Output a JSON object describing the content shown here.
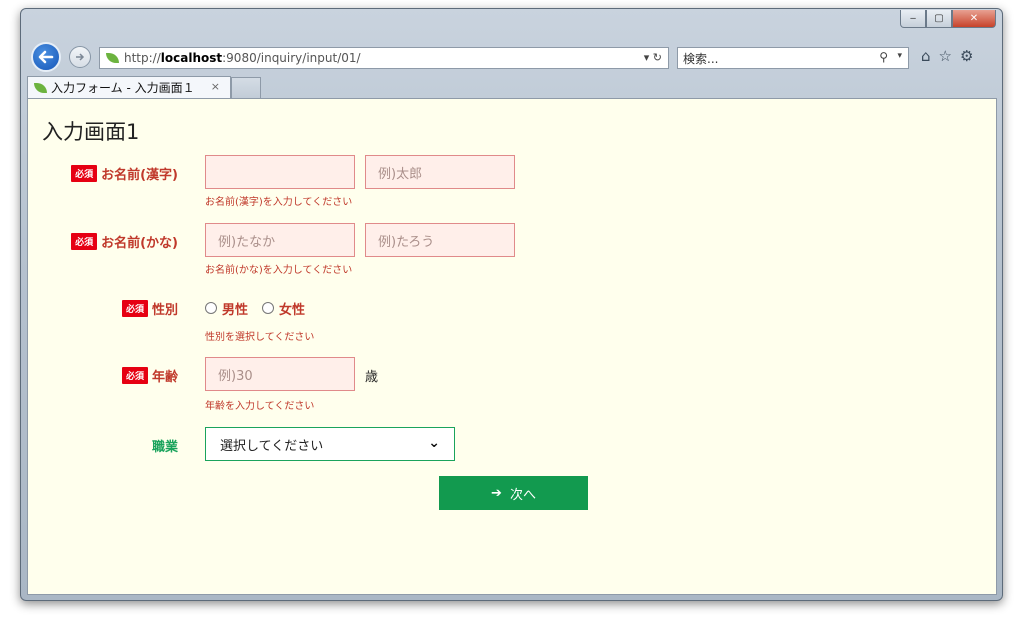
{
  "browser": {
    "url_prefix": "http://",
    "url_host": "localhost",
    "url_rest": ":9080/inquiry/input/01/",
    "address_tools": "▾ ↻",
    "search_placeholder": "検索...",
    "search_icon": "⚲",
    "search_chevron": "▾",
    "window_controls": {
      "minimize": "‒",
      "maximize": "▢",
      "close": "✕"
    },
    "toolbar": {
      "home": "⌂",
      "favorites": "☆",
      "settings": "⚙"
    },
    "tab_title": "入力フォーム - 入力画面１",
    "tab_close": "×"
  },
  "page": {
    "title": "入力画面1",
    "required_badge": "必須",
    "fields": {
      "name_kanji": {
        "label": "お名前(漢字)",
        "placeholder_last": "",
        "placeholder_first": "例)太郎",
        "hint": "お名前(漢字)を入力してください"
      },
      "name_kana": {
        "label": "お名前(かな)",
        "placeholder_last": "例)たなか",
        "placeholder_first": "例)たろう",
        "hint": "お名前(かな)を入力してください"
      },
      "gender": {
        "label": "性別",
        "options": [
          "男性",
          "女性"
        ],
        "hint": "性別を選択してください"
      },
      "age": {
        "label": "年齢",
        "placeholder": "例)30",
        "unit": "歳",
        "hint": "年齢を入力してください"
      },
      "job": {
        "label": "職業",
        "selected": "選択してください",
        "chevron": "⌄"
      }
    },
    "next_button": {
      "icon": "➔",
      "label": "次へ"
    }
  }
}
